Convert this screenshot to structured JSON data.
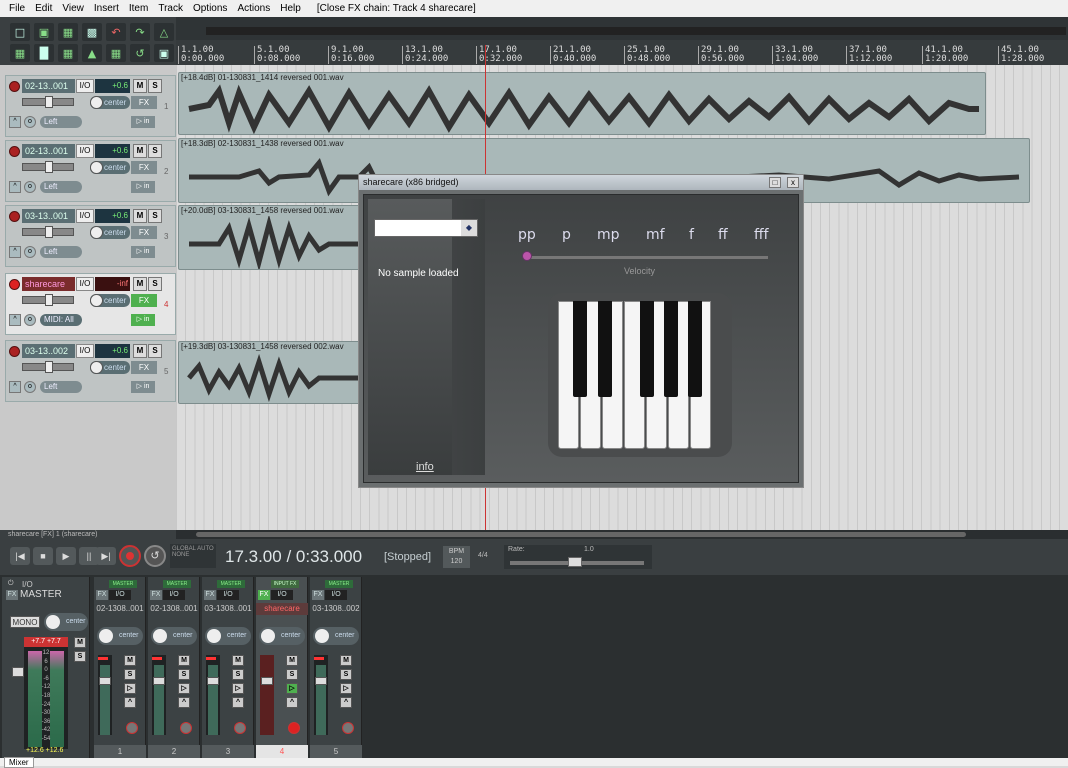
{
  "menu": [
    "File",
    "Edit",
    "View",
    "Insert",
    "Item",
    "Track",
    "Options",
    "Actions",
    "Help"
  ],
  "menu_context": "[Close FX chain: Track 4 sharecare]",
  "ruler": [
    {
      "bar": "1.1.00",
      "time": "0:00.000"
    },
    {
      "bar": "5.1.00",
      "time": "0:08.000"
    },
    {
      "bar": "9.1.00",
      "time": "0:16.000"
    },
    {
      "bar": "13.1.00",
      "time": "0:24.000"
    },
    {
      "bar": "17.1.00",
      "time": "0:32.000"
    },
    {
      "bar": "21.1.00",
      "time": "0:40.000"
    },
    {
      "bar": "25.1.00",
      "time": "0:48.000"
    },
    {
      "bar": "29.1.00",
      "time": "0:56.000"
    },
    {
      "bar": "33.1.00",
      "time": "1:04.000"
    },
    {
      "bar": "37.1.00",
      "time": "1:12.000"
    },
    {
      "bar": "41.1.00",
      "time": "1:20.000"
    },
    {
      "bar": "45.1.00",
      "time": "1:28.000"
    }
  ],
  "tracks": [
    {
      "name": "02-13..001",
      "io": "I/O",
      "volume": "+0.6",
      "pan": "center",
      "fx": "FX",
      "input": "Left",
      "num": "1"
    },
    {
      "name": "02-13..001",
      "io": "I/O",
      "volume": "+0.6",
      "pan": "center",
      "fx": "FX",
      "input": "Left",
      "num": "2"
    },
    {
      "name": "03-13..001",
      "io": "I/O",
      "volume": "+0.6",
      "pan": "center",
      "fx": "FX",
      "input": "Left",
      "num": "3"
    },
    {
      "name": "sharecare",
      "io": "I/O",
      "volume": "-inf",
      "pan": "center",
      "fx": "FX",
      "input": "MIDI: All",
      "num": "4"
    },
    {
      "name": "03-13..002",
      "io": "I/O",
      "volume": "+0.6",
      "pan": "center",
      "fx": "FX",
      "input": "Left",
      "num": "5"
    }
  ],
  "items": [
    "[+18.4dB] 01-130831_1414 reversed 001.wav",
    "[+18.3dB] 02-130831_1438 reversed 001.wav",
    "[+20.0dB] 03-130831_1458 reversed 001.wav",
    "[+19.3dB] 03-130831_1458 reversed 002.wav"
  ],
  "status_line": "sharecare [FX] 1 (sharecare)",
  "transport": {
    "global_auto": "GLOBAL AUTO",
    "global_auto_mode": "NONE",
    "time": "17.3.00 / 0:33.000",
    "state": "[Stopped]",
    "bpm_label": "BPM",
    "bpm": "120",
    "sig": "4/4",
    "rate_label": "Rate:",
    "rate": "1.0"
  },
  "mixer": {
    "master": {
      "name": "MASTER",
      "io": "I/O",
      "mono": "MONO",
      "pan": "center",
      "peak_l": "+12.6",
      "peak_r": "+12.6",
      "fx": "FX",
      "ticks": [
        "12",
        "6",
        "0",
        "-6",
        "-12",
        "-18",
        "-24",
        "-30",
        "-36",
        "-42",
        "-54"
      ],
      "db_readout_l": "+7.7",
      "db_readout_r": "+7.7"
    },
    "strips": [
      {
        "name": "02-1308..001",
        "num": "1",
        "route": "MASTER",
        "io": "I/O",
        "pan": "center",
        "fx": "FX"
      },
      {
        "name": "02-1308..001",
        "num": "2",
        "route": "MASTER",
        "io": "I/O",
        "pan": "center",
        "fx": "FX"
      },
      {
        "name": "03-1308..001",
        "num": "3",
        "route": "MASTER",
        "io": "I/O",
        "pan": "center",
        "fx": "FX"
      },
      {
        "name": "sharecare",
        "num": "4",
        "route": "INPUT FX",
        "io": "I/O",
        "pan": "center",
        "fx": "FX"
      },
      {
        "name": "03-1308..002",
        "num": "5",
        "route": "MASTER",
        "io": "I/O",
        "pan": "center",
        "fx": "FX"
      }
    ],
    "tab": "Mixer"
  },
  "plugin": {
    "title": "sharecare (x86 bridged)",
    "no_sample": "No sample loaded",
    "info": "info",
    "velocities": [
      "pp",
      "p",
      "mp",
      "mf",
      "f",
      "ff",
      "fff"
    ],
    "velocity_label": "Velocity"
  },
  "buttons": {
    "mute": "M",
    "solo": "S",
    "close": "x",
    "pin": "□"
  }
}
